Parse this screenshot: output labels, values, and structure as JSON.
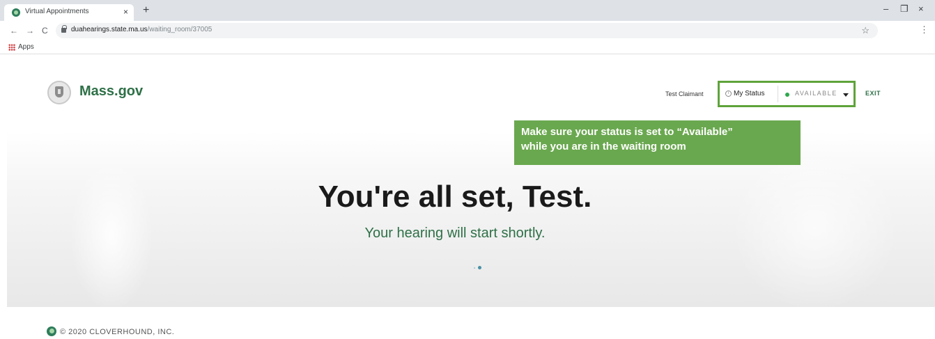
{
  "browser": {
    "tab_title": "Virtual Appointments",
    "tab_close": "×",
    "new_tab": "+",
    "window_controls": {
      "minimize": "–",
      "restore": "❐",
      "close": "×"
    },
    "nav": {
      "back": "←",
      "forward": "→",
      "reload": "C"
    },
    "url_host": "duahearings.state.ma.us",
    "url_path": "/waiting_room/37005",
    "star": "☆",
    "menu": "⋮",
    "bookmarks": {
      "apps_label": "Apps"
    }
  },
  "header": {
    "brand": "Mass.gov",
    "user_name": "Test Claimant",
    "status_label": "My Status",
    "info_glyph": "i",
    "status_value": "AVAILABLE",
    "exit_label": "EXIT",
    "status_color": "#2fa84f",
    "highlight_color": "#5fa33b"
  },
  "callout": {
    "line1": "Make sure your status is set to “Available”",
    "line2": "while you are in the waiting room",
    "color": "#6aa84f"
  },
  "hero": {
    "title": "You're all set, Test.",
    "subtitle": "Your hearing will start shortly."
  },
  "footer": {
    "copyright": "© 2020 CLOVERHOUND, INC."
  },
  "icons": [
    "favicon",
    "close-icon",
    "plus-icon",
    "back-arrow-icon",
    "forward-arrow-icon",
    "reload-icon",
    "lock-icon",
    "star-icon",
    "menu-icon",
    "apps-grid-icon",
    "seal-icon",
    "info-icon",
    "status-dot-icon",
    "caret-down-icon",
    "loading-dots-icon",
    "cloverhound-logo-icon"
  ]
}
